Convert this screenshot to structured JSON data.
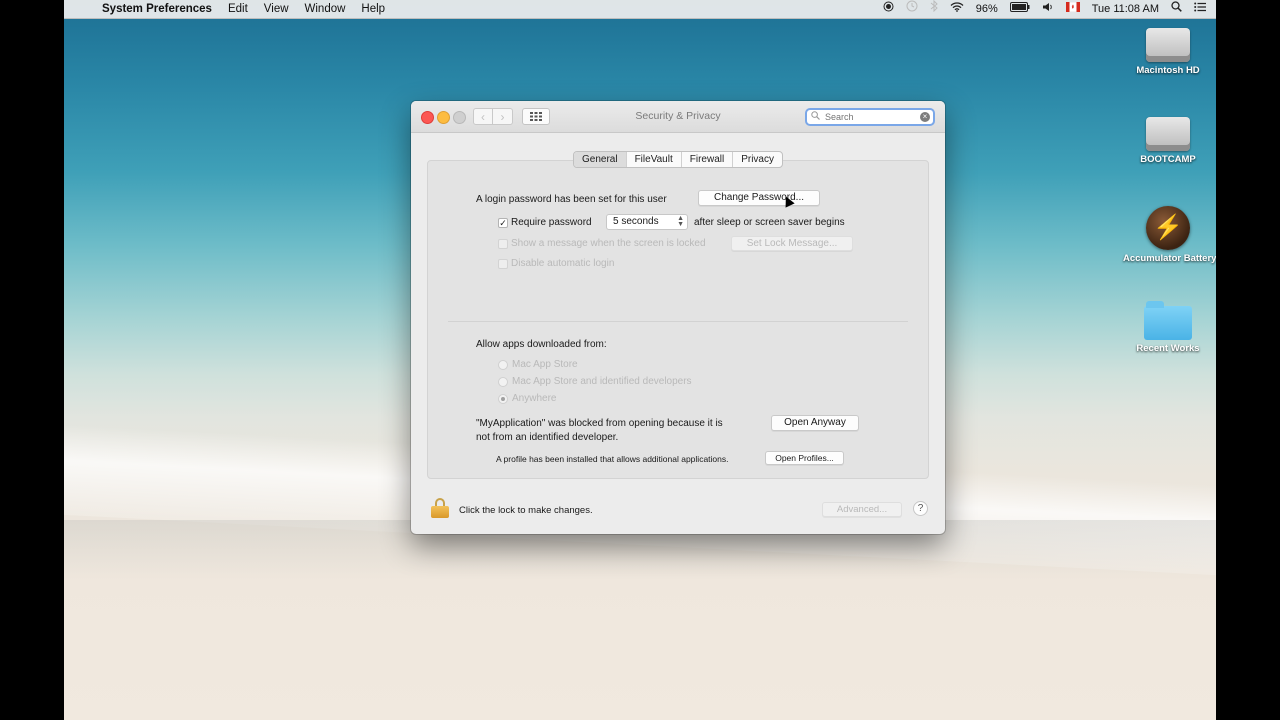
{
  "menubar": {
    "apple": "",
    "app_name": "System Preferences",
    "menus": [
      "Edit",
      "View",
      "Window",
      "Help"
    ],
    "battery": "96%",
    "clock": "Tue 11:08 AM"
  },
  "desktop_icons": [
    {
      "label": "Macintosh HD"
    },
    {
      "label": "BOOTCAMP"
    },
    {
      "label": "Accumulator Battery"
    },
    {
      "label": "Recent Works"
    }
  ],
  "window": {
    "title": "Security & Privacy",
    "search_placeholder": "Search",
    "tabs": [
      "General",
      "FileVault",
      "Firewall",
      "Privacy"
    ],
    "active_tab": "General",
    "login_text": "A login password has been set for this user",
    "change_password": "Change Password...",
    "require_password": {
      "label": "Require password",
      "checked": true,
      "value": "5 seconds",
      "suffix": "after sleep or screen saver begins"
    },
    "show_message": {
      "label": "Show a message when the screen is locked",
      "checked": false
    },
    "set_lock_message": "Set Lock Message...",
    "disable_auto_login": {
      "label": "Disable automatic login",
      "checked": false
    },
    "allow_apps": {
      "label": "Allow apps downloaded from:",
      "options": [
        "Mac App Store",
        "Mac App Store and identified developers",
        "Anywhere"
      ],
      "selected": "Anywhere"
    },
    "blocked_text_1": "\"MyApplication\" was blocked from opening because it is",
    "blocked_text_2": "not from an identified developer.",
    "open_anyway": "Open Anyway",
    "profile_text": "A profile has been installed that allows additional applications.",
    "open_profiles": "Open Profiles...",
    "lock_text": "Click the lock to make changes.",
    "advanced": "Advanced...",
    "help": "?"
  }
}
